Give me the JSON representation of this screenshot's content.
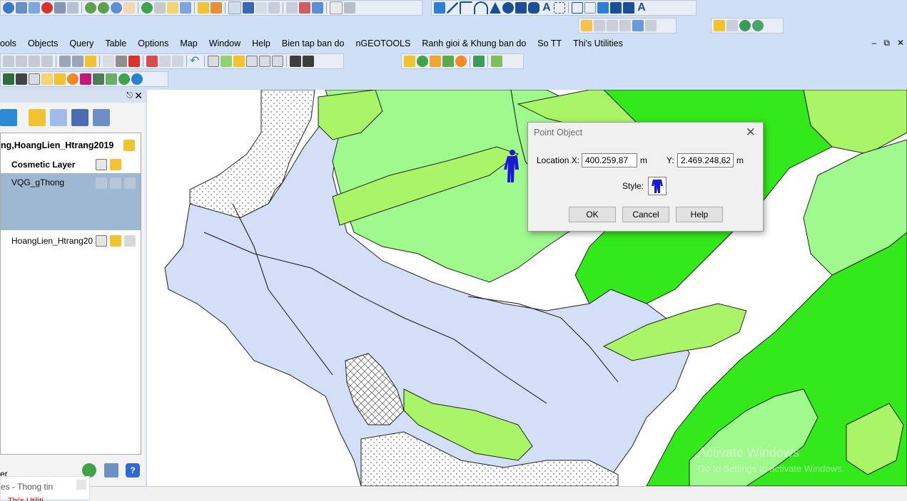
{
  "menubar": {
    "items": [
      "ools",
      "Objects",
      "Query",
      "Table",
      "Options",
      "Map",
      "Window",
      "Help",
      "Bien tap ban do",
      "nGEOTOOLS",
      "Ranh gioi & Khung ban do",
      "So TT",
      "Thi's Utilities"
    ]
  },
  "layer_panel": {
    "header": "ng,HoangLien_Htrang2019 I",
    "layers": [
      {
        "name": "Cosmetic Layer"
      },
      {
        "name": "VQG_gThong"
      },
      {
        "name": "HoangLien_Htrang20"
      }
    ]
  },
  "bottom_tab": {
    "label": "es - Thong tin",
    "sub": "Thi's Utiliti"
  },
  "bottom_left_text": "er",
  "dialog": {
    "title": "Point Object",
    "location_x_label": "Location X:",
    "location_x_value": "400.259,87",
    "unit_x": "m",
    "y_label": "Y:",
    "y_value": "2.469.248,62",
    "unit_y": "m",
    "style_label": "Style:",
    "ok": "OK",
    "cancel": "Cancel",
    "help": "Help"
  },
  "watermark": {
    "line1": "Activate Windows",
    "line2": "Go to Settings to activate Windows."
  },
  "colors": {
    "light_green": "#a9f567",
    "bright_green": "#33e81b",
    "pale_green": "#9ff98d",
    "lavender": "#d3def7",
    "water_blue": "#c8d6f5"
  }
}
